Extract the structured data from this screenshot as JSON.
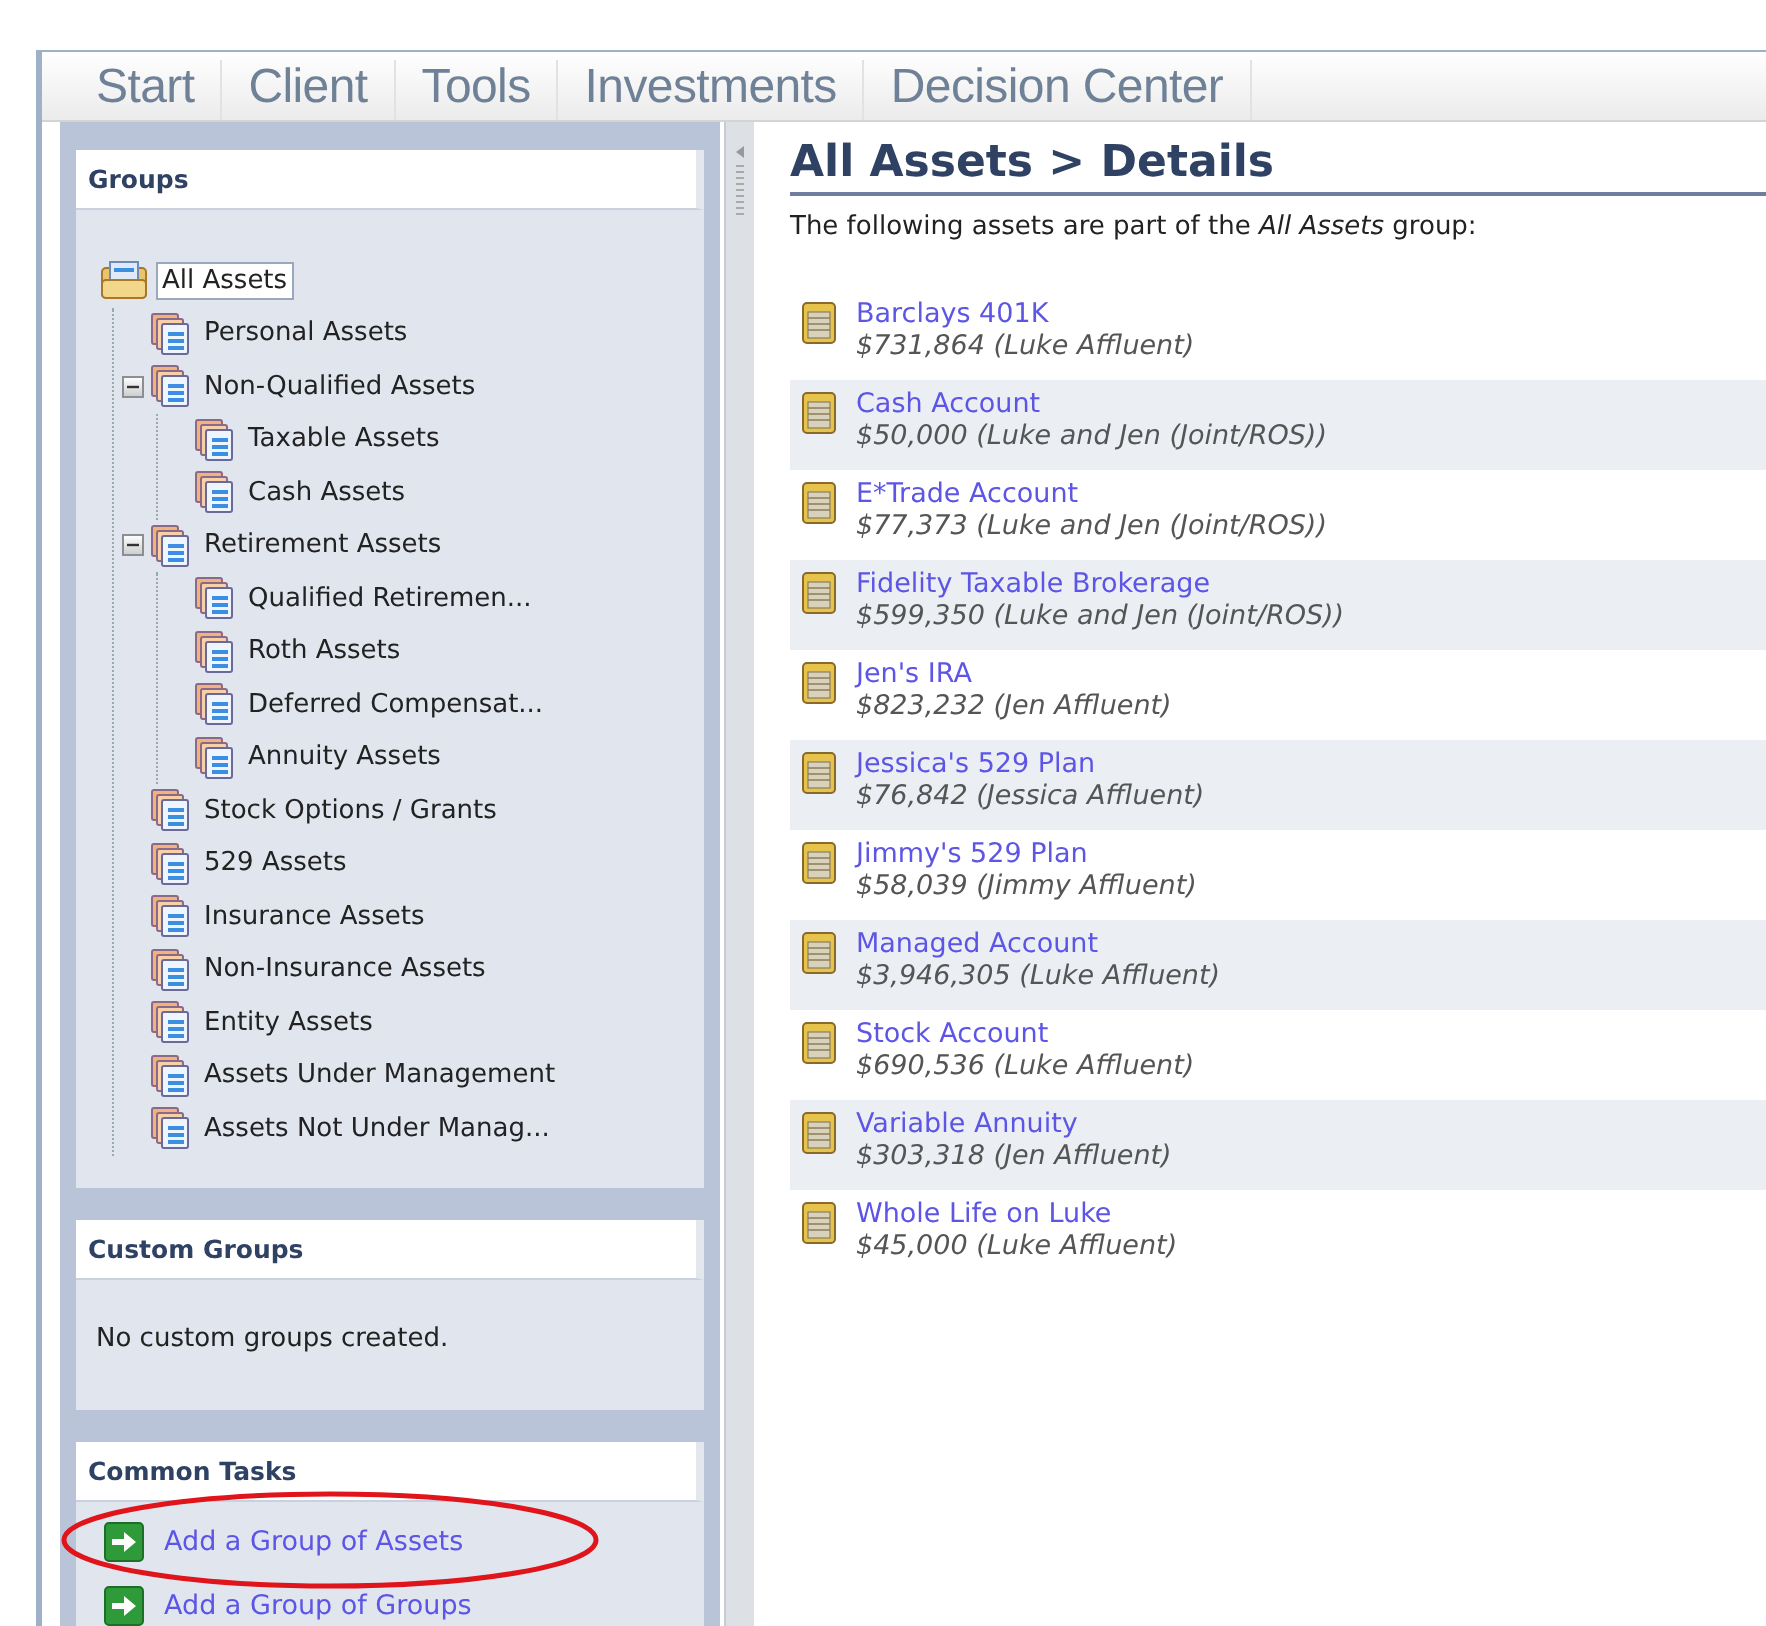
{
  "nav": [
    {
      "label": "Start"
    },
    {
      "label": "Client"
    },
    {
      "label": "Tools"
    },
    {
      "label": "Investments"
    },
    {
      "label": "Decision Center"
    }
  ],
  "groups": {
    "title": "Groups",
    "tree": [
      {
        "label": "All Assets",
        "selected": true,
        "children": [
          {
            "label": "Personal Assets",
            "selected": false
          },
          {
            "label": "Non-Qualified Assets",
            "selected": false,
            "expanded": true,
            "children": [
              {
                "label": "Taxable Assets",
                "selected": false
              },
              {
                "label": "Cash Assets",
                "selected": false
              }
            ]
          },
          {
            "label": "Retirement Assets",
            "selected": false,
            "expanded": true,
            "children": [
              {
                "label": "Qualified Retiremen...",
                "selected": false
              },
              {
                "label": "Roth Assets",
                "selected": false
              },
              {
                "label": "Deferred Compensat...",
                "selected": false
              },
              {
                "label": "Annuity Assets",
                "selected": false
              }
            ]
          },
          {
            "label": "Stock Options / Grants",
            "selected": false
          },
          {
            "label": "529 Assets",
            "selected": false
          },
          {
            "label": "Insurance Assets",
            "selected": false
          },
          {
            "label": "Non-Insurance Assets",
            "selected": false
          },
          {
            "label": "Entity Assets",
            "selected": false
          },
          {
            "label": "Assets Under Management",
            "selected": false
          },
          {
            "label": "Assets Not Under Manag...",
            "selected": false
          }
        ]
      }
    ]
  },
  "custom_groups": {
    "title": "Custom Groups",
    "message": "No custom groups created."
  },
  "common_tasks": {
    "title": "Common Tasks",
    "items": [
      {
        "label": "Add a Group of Assets",
        "highlighted": true
      },
      {
        "label": "Add a Group of Groups",
        "highlighted": false
      }
    ]
  },
  "details": {
    "title": "All Assets > Details",
    "intro": "The following assets are part of the *All Assets* group:",
    "assets": [
      {
        "name": "Barclays 401K",
        "value": "$731,864 (Luke Affluent)"
      },
      {
        "name": "Cash Account",
        "value": "$50,000 (Luke and Jen (Joint/ROS))"
      },
      {
        "name": "E*Trade Account",
        "value": "$77,373 (Luke and Jen (Joint/ROS))"
      },
      {
        "name": "Fidelity Taxable Brokerage",
        "value": "$599,350 (Luke and Jen (Joint/ROS))"
      },
      {
        "name": "Jen's IRA",
        "value": "$823,232 (Jen Affluent)"
      },
      {
        "name": "Jessica's 529 Plan",
        "value": "$76,842 (Jessica Affluent)"
      },
      {
        "name": "Jimmy's 529 Plan",
        "value": "$58,039 (Jimmy Affluent)"
      },
      {
        "name": "Managed Account",
        "value": "$3,946,305 (Luke Affluent)"
      },
      {
        "name": "Stock Account",
        "value": "$690,536 (Luke Affluent)"
      },
      {
        "name": "Variable Annuity",
        "value": "$303,318 (Jen Affluent)"
      },
      {
        "name": "Whole Life on Luke",
        "value": "$45,000 (Luke Affluent)"
      }
    ]
  }
}
